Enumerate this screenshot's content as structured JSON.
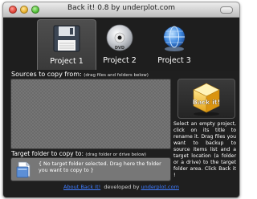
{
  "window": {
    "title": "Back it! 0.8 by underplot.com"
  },
  "projects": [
    {
      "label": "Project 1",
      "icon": "floppy-disk-icon",
      "active": true
    },
    {
      "label": "Project 2",
      "icon": "dvd-disc-icon",
      "active": false
    },
    {
      "label": "Project 3",
      "icon": "globe-icon",
      "active": false
    }
  ],
  "sources": {
    "title": "Sources to copy from:",
    "hint": "(drag files and folders below)"
  },
  "target": {
    "title": "Target folder to copy to:",
    "hint": "(drag folder or drive below)",
    "placeholder": "{ No target folder selected. Drag here the folder you want to copy to }"
  },
  "backit": {
    "label": "Back it!",
    "instructions": "Select an empty project, click on its title to rename it. Drag files you want to backup to source items list and a target location (a folder or a drive) to the target folder area. Click Back it !"
  },
  "footer": {
    "about_link": "About Back It!",
    "developed_by": "developed by",
    "developer_link": "underplot.com"
  },
  "colors": {
    "window_background": "#1f1f1f",
    "panel_gray": "#6b6b6b",
    "link_blue": "#3f7cff"
  }
}
